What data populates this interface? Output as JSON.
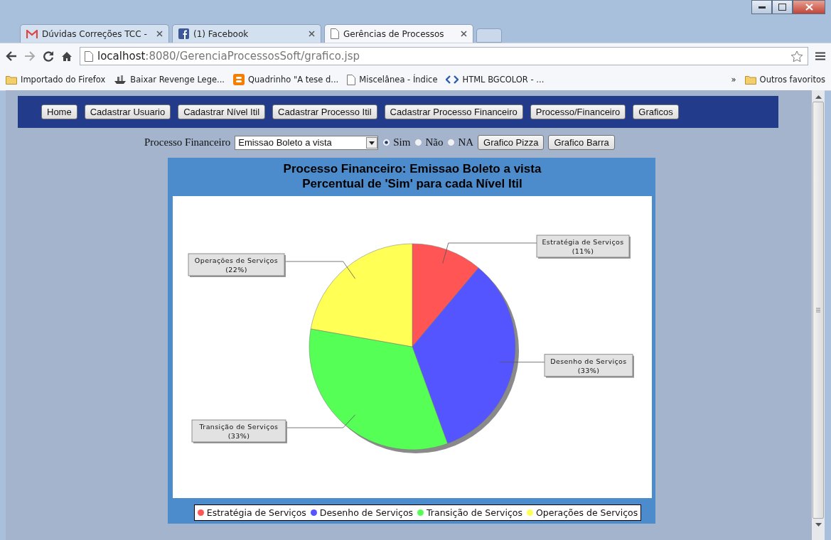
{
  "browser": {
    "tabs": [
      {
        "title": "Dúvidas Correções TCC -",
        "selected": false
      },
      {
        "title": "(1) Facebook",
        "selected": false
      },
      {
        "title": "Gerências de Processos",
        "selected": true
      }
    ],
    "url": {
      "host": "localhost",
      "path": ":8080/GerenciaProcessosSoft/grafico.jsp"
    },
    "bookmarks": [
      {
        "label": "Importado do Firefox",
        "kind": "folder"
      },
      {
        "label": "Baixar Revenge Lege...",
        "kind": "ship"
      },
      {
        "label": "Quadrinho \"A tese d...",
        "kind": "blog"
      },
      {
        "label": "Miscelânea - Índice",
        "kind": "page"
      },
      {
        "label": "HTML BGCOLOR - ...",
        "kind": "code"
      }
    ],
    "overflow": "»",
    "other_bookmarks": "Outros favoritos"
  },
  "nav": {
    "buttons": [
      "Home",
      "Cadastrar Usuario",
      "Cadastrar Nível Itil",
      "Cadastrar Processo Itil",
      "Cadastrar Processo Financeiro",
      "Processo/Financeiro",
      "Graficos"
    ]
  },
  "filter": {
    "label": "Processo Financeiro",
    "select_value": "Emissao Boleto a vista",
    "options": [
      {
        "label": "Sim",
        "selected": true
      },
      {
        "label": "Não",
        "selected": false
      },
      {
        "label": "NA",
        "selected": false
      }
    ],
    "buttons": [
      "Grafico Pizza",
      "Grafico Barra"
    ]
  },
  "chart": {
    "title_lines": [
      "Processo Financeiro: Emissao Boleto a vista",
      "Percentual de 'Sim' para cada Nível Itil"
    ],
    "chart_data": {
      "type": "pie",
      "categories": [
        "Estratégia de Serviços",
        "Desenho de Serviços",
        "Transição de Serviços",
        "Operações de Serviços"
      ],
      "values": [
        11,
        33,
        33,
        22
      ],
      "value_labels": [
        "(11%)",
        "(33%)",
        "(33%)",
        "(22%)"
      ]
    },
    "legend": [
      {
        "label": "Estratégia de Serviços",
        "color": "#ff5555"
      },
      {
        "label": "Desenho de Serviços",
        "color": "#5555ff"
      },
      {
        "label": "Transição de Serviços",
        "color": "#55ff55"
      },
      {
        "label": "Operações de Serviços",
        "color": "#ffff55"
      }
    ]
  }
}
